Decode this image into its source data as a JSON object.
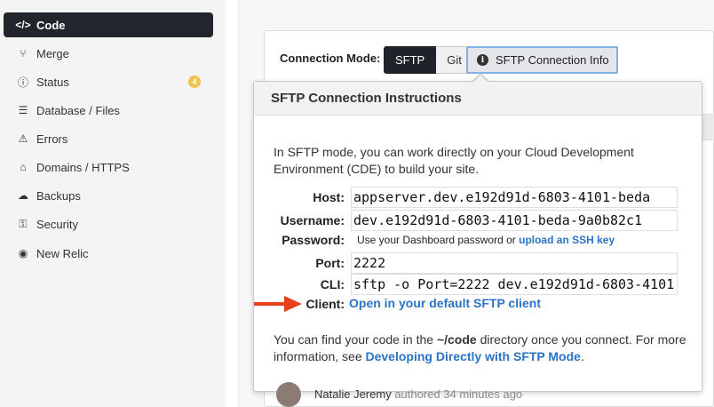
{
  "sidebar": {
    "items": [
      {
        "label": "Code",
        "icon": "code-icon",
        "glyph": "</>",
        "active": true
      },
      {
        "label": "Merge",
        "icon": "merge-icon",
        "glyph": "⑂"
      },
      {
        "label": "Status",
        "icon": "info-icon",
        "glyph": "ⓘ",
        "badge": "4"
      },
      {
        "label": "Database / Files",
        "icon": "database-icon",
        "glyph": "☰"
      },
      {
        "label": "Errors",
        "icon": "warning-icon",
        "glyph": "⚠"
      },
      {
        "label": "Domains / HTTPS",
        "icon": "home-icon",
        "glyph": "⌂"
      },
      {
        "label": "Backups",
        "icon": "cloud-upload-icon",
        "glyph": "☁"
      },
      {
        "label": "Security",
        "icon": "key-icon",
        "glyph": "⚿"
      },
      {
        "label": "New Relic",
        "icon": "eye-icon",
        "glyph": "◉"
      }
    ]
  },
  "toolbar": {
    "connection_mode_label": "Connection Mode:",
    "sftp_label": "SFTP",
    "git_label": "Git",
    "info_button_label": "SFTP Connection Info"
  },
  "popover": {
    "title": "SFTP Connection Instructions",
    "intro": "In SFTP mode, you can work directly on your Cloud Development Environment (CDE) to build your site.",
    "host_label": "Host:",
    "host_value": "appserver.dev.e192d91d-6803-4101-beda",
    "username_label": "Username:",
    "username_value": "dev.e192d91d-6803-4101-beda-9a0b82c1",
    "password_label": "Password:",
    "password_text": "Use your Dashboard password or",
    "password_link": "upload an SSH key",
    "port_label": "Port:",
    "port_value": "2222",
    "cli_label": "CLI:",
    "cli_value": "sftp -o Port=2222 dev.e192d91d-6803-4101",
    "client_label": "Client:",
    "client_link": "Open in your default SFTP client",
    "outro_1": "You can find your code in the",
    "outro_code": "~/code",
    "outro_2": "directory once you connect. For more information, see",
    "outro_link": "Developing Directly with SFTP Mode",
    "outro_end": "."
  },
  "footer": {
    "author": "Natalie Jeremy",
    "meta": "authored 34 minutes ago"
  },
  "colors": {
    "accent_link": "#2a73c5",
    "active_nav": "#22252b",
    "badge": "#f0c350",
    "arrow": "#e8401c"
  }
}
